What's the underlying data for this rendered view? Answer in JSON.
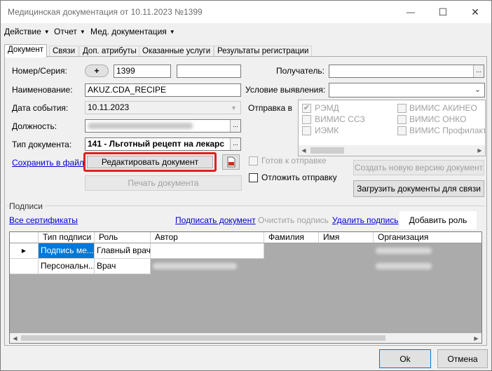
{
  "window": {
    "title": "Медицинская документация от 10.11.2023 №1399",
    "controls": {
      "minimize": "—",
      "maximize": "☐",
      "close": "✕"
    }
  },
  "menu": [
    {
      "label": "Действие"
    },
    {
      "label": "Отчет"
    },
    {
      "label": "Мед. документация"
    }
  ],
  "tabs": [
    {
      "label": "Документ",
      "active": true
    },
    {
      "label": "Связи"
    },
    {
      "label": "Доп. атрибуты"
    },
    {
      "label": "Оказанные услуги"
    },
    {
      "label": "Результаты регистрации"
    }
  ],
  "form": {
    "number_label": "Номер/Серия:",
    "plus_button": "+",
    "number_value": "1399",
    "series_value": "",
    "recipient_label": "Получатель:",
    "recipient_value": "",
    "name_label": "Наименование:",
    "name_value": "AKUZ.CDA_RECIPE",
    "condition_label": "Условие выявления:",
    "condition_value": "",
    "event_date_label": "Дата события:",
    "event_date_value": "10.11.2023",
    "send_to_label": "Отправка в",
    "position_label": "Должность:",
    "doc_type_label": "Тип документа:",
    "doc_type_value": "141 - Льготный рецепт на лекарс",
    "dots_label": "...",
    "save_to_file_link": "Сохранить в файл",
    "edit_document_button": "Редактировать документ",
    "print_document_button": "Печать документа",
    "ready_to_send_label": "Готов к отправке",
    "postpone_send_label": "Отложить отправку",
    "create_new_version_button": "Создать новую версию документ",
    "load_documents_button": "Загрузить документы для связи"
  },
  "send_targets": [
    {
      "label": "РЭМД",
      "checked": true,
      "disabled": true
    },
    {
      "label": "ВИМИС АКИНЕО",
      "checked": false,
      "disabled": true
    },
    {
      "label": "ВИМИС ССЗ",
      "checked": false,
      "disabled": true
    },
    {
      "label": "ВИМИС ОНКО",
      "checked": false,
      "disabled": true
    },
    {
      "label": "ИЭМК",
      "checked": false,
      "disabled": true
    },
    {
      "label": "ВИМИС Профилактик",
      "checked": false,
      "disabled": true
    }
  ],
  "signatures": {
    "group_label": "Подписи",
    "all_certificates_link": "Все сертификаты",
    "sign_document_link": "Подписать документ",
    "clear_signature_label": "Очистить подпись",
    "delete_signature_link": "Удалить подпись",
    "add_role_button": "Добавить роль",
    "columns": [
      "Тип подписи",
      "Роль",
      "Автор",
      "Фамилия",
      "Имя",
      "Организация"
    ],
    "rows": [
      {
        "type": "Подпись ме...",
        "role": "Главный врач",
        "current": true
      },
      {
        "type": "Персональн...",
        "role": "Врач",
        "current": false
      }
    ]
  },
  "footer": {
    "ok_button": "Ok",
    "cancel_button": "Отмена"
  },
  "colors": {
    "selection": "#0078d7",
    "link": "#0000cc",
    "highlight_border": "#e02020"
  }
}
